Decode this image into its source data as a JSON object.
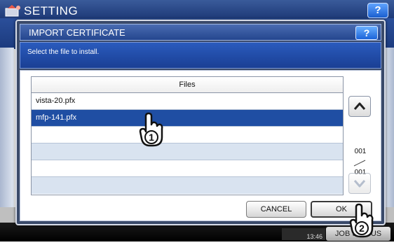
{
  "background": {
    "title": "SETTING",
    "help_label": "?",
    "time": "13:46",
    "job_status_label": "JOB STATUS"
  },
  "dialog": {
    "title": "IMPORT CERTIFICATE",
    "help_label": "?",
    "message": "Select the file to install.",
    "table": {
      "header": "Files",
      "rows": [
        {
          "name": "vista-20.pfx",
          "selected": false
        },
        {
          "name": "mfp-141.pfx",
          "selected": true
        },
        {
          "name": "",
          "selected": false
        },
        {
          "name": "",
          "selected": false
        },
        {
          "name": "",
          "selected": false
        },
        {
          "name": "",
          "selected": false
        }
      ]
    },
    "pager": {
      "current": "001",
      "total": "001"
    },
    "buttons": {
      "cancel": "CANCEL",
      "ok": "OK"
    }
  },
  "callouts": {
    "step1": "1",
    "step2": "2"
  },
  "colors": {
    "selected_row": "#1f4ea3",
    "title_bar": "#24468e",
    "help_button": "#1b63d8"
  }
}
